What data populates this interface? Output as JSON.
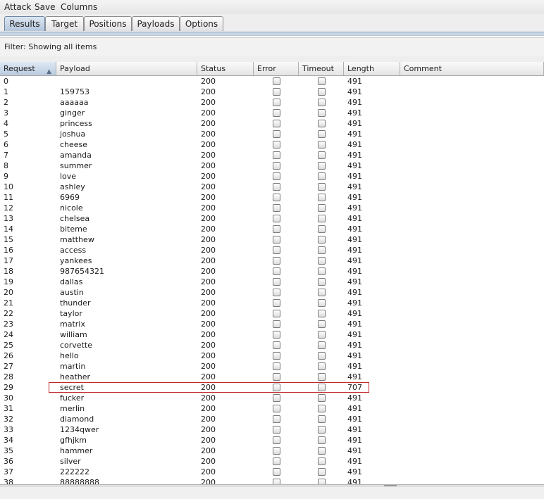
{
  "menu": [
    "Attack",
    "Save",
    "Columns"
  ],
  "tabs": [
    {
      "label": "Results",
      "active": true
    },
    {
      "label": "Target",
      "active": false
    },
    {
      "label": "Positions",
      "active": false
    },
    {
      "label": "Payloads",
      "active": false
    },
    {
      "label": "Options",
      "active": false
    }
  ],
  "filter": {
    "text": "Filter: Showing all items"
  },
  "columns": [
    "Request",
    "Payload",
    "Status",
    "Error",
    "Timeout",
    "Length",
    "Comment"
  ],
  "sorted_column": "Request",
  "rows": [
    [
      "0",
      "",
      "200",
      "491"
    ],
    [
      "1",
      "159753",
      "200",
      "491"
    ],
    [
      "2",
      "aaaaaa",
      "200",
      "491"
    ],
    [
      "3",
      "ginger",
      "200",
      "491"
    ],
    [
      "4",
      "princess",
      "200",
      "491"
    ],
    [
      "5",
      "joshua",
      "200",
      "491"
    ],
    [
      "6",
      "cheese",
      "200",
      "491"
    ],
    [
      "7",
      "amanda",
      "200",
      "491"
    ],
    [
      "8",
      "summer",
      "200",
      "491"
    ],
    [
      "9",
      "love",
      "200",
      "491"
    ],
    [
      "10",
      "ashley",
      "200",
      "491"
    ],
    [
      "11",
      "6969",
      "200",
      "491"
    ],
    [
      "12",
      "nicole",
      "200",
      "491"
    ],
    [
      "13",
      "chelsea",
      "200",
      "491"
    ],
    [
      "14",
      "biteme",
      "200",
      "491"
    ],
    [
      "15",
      "matthew",
      "200",
      "491"
    ],
    [
      "16",
      "access",
      "200",
      "491"
    ],
    [
      "17",
      "yankees",
      "200",
      "491"
    ],
    [
      "18",
      "987654321",
      "200",
      "491"
    ],
    [
      "19",
      "dallas",
      "200",
      "491"
    ],
    [
      "20",
      "austin",
      "200",
      "491"
    ],
    [
      "21",
      "thunder",
      "200",
      "491"
    ],
    [
      "22",
      "taylor",
      "200",
      "491"
    ],
    [
      "23",
      "matrix",
      "200",
      "491"
    ],
    [
      "24",
      "william",
      "200",
      "491"
    ],
    [
      "25",
      "corvette",
      "200",
      "491"
    ],
    [
      "26",
      "hello",
      "200",
      "491"
    ],
    [
      "27",
      "martin",
      "200",
      "491"
    ],
    [
      "28",
      "heather",
      "200",
      "491"
    ],
    [
      "29",
      "secret",
      "200",
      "707"
    ],
    [
      "30",
      "fucker",
      "200",
      "491"
    ],
    [
      "31",
      "merlin",
      "200",
      "491"
    ],
    [
      "32",
      "diamond",
      "200",
      "491"
    ],
    [
      "33",
      "1234qwer",
      "200",
      "491"
    ],
    [
      "34",
      "gfhjkm",
      "200",
      "491"
    ],
    [
      "35",
      "hammer",
      "200",
      "491"
    ],
    [
      "36",
      "silver",
      "200",
      "491"
    ],
    [
      "37",
      "222222",
      "200",
      "491"
    ],
    [
      "38",
      "88888888",
      "200",
      "491"
    ]
  ],
  "highlighted_request": "29",
  "colors": {
    "highlight_border": "#c0282c",
    "active_tab": "#b5c7dc"
  }
}
